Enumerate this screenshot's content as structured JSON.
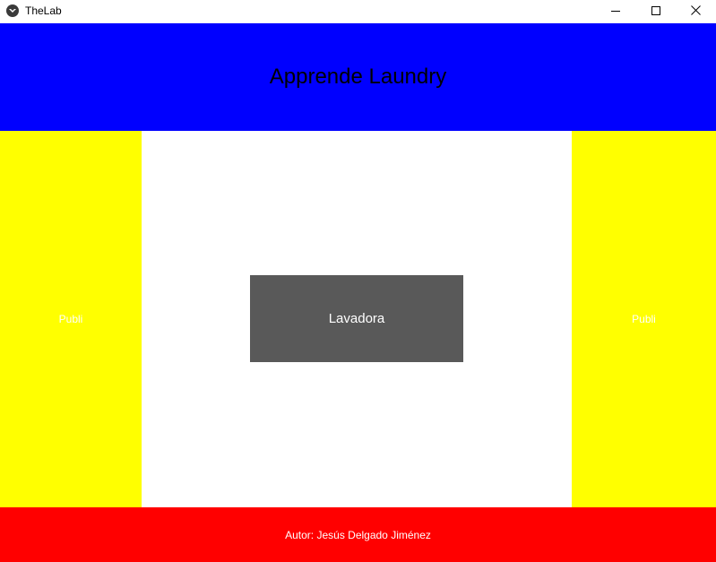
{
  "window": {
    "title": "TheLab",
    "controls": {
      "minimize_icon": "minimize-icon",
      "maximize_icon": "maximize-icon",
      "close_icon": "close-icon"
    }
  },
  "header": {
    "title": "Apprende Laundry",
    "color": "#0000ff"
  },
  "sidebar_left": {
    "label": "Publi",
    "color": "#ffff00"
  },
  "sidebar_right": {
    "label": "Publi",
    "color": "#ffff00"
  },
  "main": {
    "button_label": "Lavadora",
    "button_color": "#595959"
  },
  "footer": {
    "text": "Autor: Jesús Delgado Jiménez",
    "color": "#ff0000"
  }
}
